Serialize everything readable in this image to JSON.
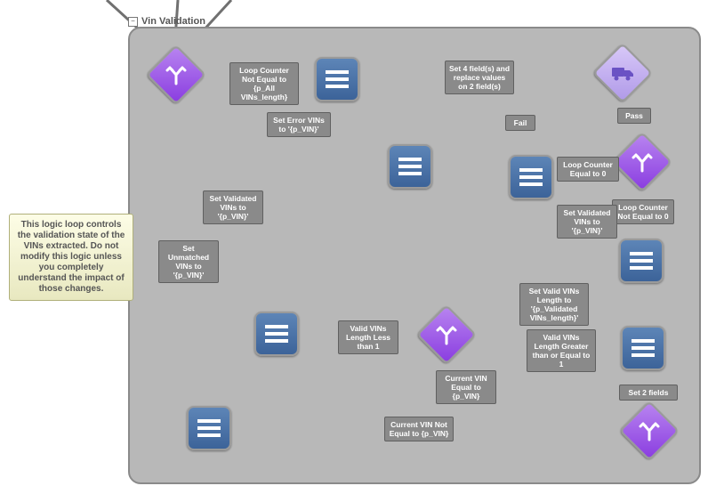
{
  "header": {
    "title": "Vin Validation"
  },
  "note": {
    "text": "This logic loop controls the validation state of the VINs extracted.  Do not modify this logic unless you completely understand the impact of those changes."
  },
  "nodes": {
    "decision1": {
      "icon": "fork-icon"
    },
    "list1": {
      "icon": "list-icon"
    },
    "truck": {
      "icon": "truck-icon"
    },
    "decision2": {
      "icon": "fork-icon"
    },
    "list2": {
      "icon": "list-icon"
    },
    "list3": {
      "icon": "list-icon"
    },
    "list4": {
      "icon": "list-icon"
    },
    "list5": {
      "icon": "list-icon"
    },
    "decision3": {
      "icon": "fork-icon"
    },
    "list6": {
      "icon": "list-icon"
    },
    "list7": {
      "icon": "list-icon"
    },
    "decision4": {
      "icon": "fork-icon"
    }
  },
  "edges": {
    "e1": "Loop Counter Not Equal to {p_All VINs_length}",
    "e2": "Set 4 field(s) and replace values on 2 field(s)",
    "e_fail": "Fail",
    "e_pass": "Pass",
    "e3": "Set Error VINs to '{p_VIN}'",
    "e4": "Set Validated VINs to '{p_VIN}'",
    "e5": "Set Unmatched VINs to '{p_VIN}'",
    "e6": "Loop Counter Equal to 0",
    "e7": "Loop Counter Not Equal to 0",
    "e8": "Set Validated VINs to '{p_VIN}'",
    "e9": "Set Valid VINs Length to '{p_Validated VINs_length}'",
    "e10": "Valid VINs Length Less than 1",
    "e11": "Valid VINs Length Greater than or Equal to 1",
    "e12": "Current VIN Equal to {p_VIN}",
    "e13": "Set 2 fields",
    "e14": "Current VIN Not Equal to {p_VIN}"
  }
}
